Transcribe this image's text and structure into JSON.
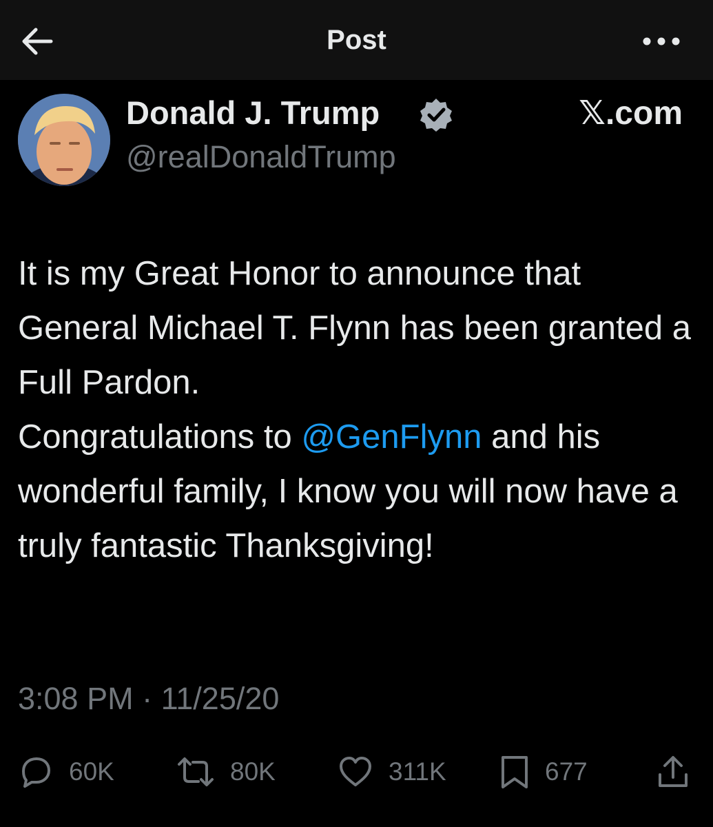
{
  "header": {
    "title": "Post",
    "back_icon": "arrow-left-icon",
    "more_icon": "more-horizontal-icon"
  },
  "post": {
    "author": {
      "name": "Donald J. Trump",
      "handle": "@realDonaldTrump",
      "verified_icon": "verified-badge-icon",
      "verified_color": "#1d9bf0"
    },
    "source": "𝕏.com",
    "text": {
      "part1": "It is my Great Honor to announce that General Michael T. Flynn has been granted a Full Pardon.",
      "part2": "Congratulations to ",
      "mention": "@GenFlynn",
      "part3": " and his wonderful family, I know you will now have a truly fantastic Thanksgiving!"
    },
    "timestamp": "3:08 PM · 11/25/20",
    "stats": {
      "replies": "60K",
      "reposts": "80K",
      "likes": "311K",
      "bookmarks": "677"
    }
  },
  "colors": {
    "background": "#000000",
    "header_bg": "#111111",
    "text": "#e7e9ea",
    "muted": "#71767b",
    "link": "#1d9bf0"
  }
}
